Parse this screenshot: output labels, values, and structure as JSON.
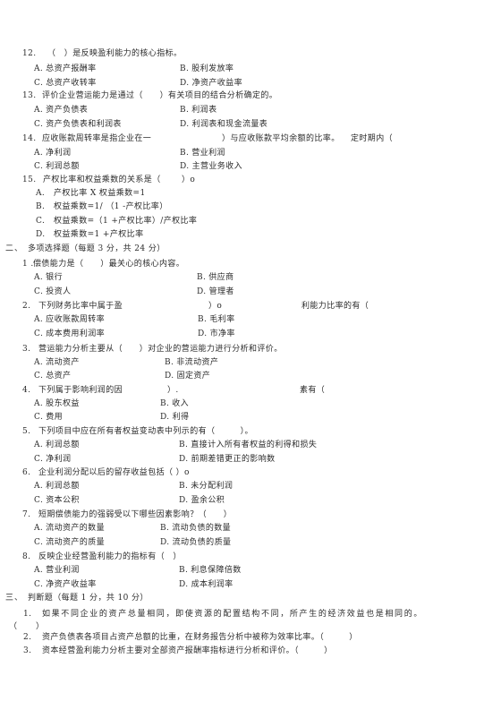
{
  "single_choice": {
    "questions": [
      {
        "number": "12.",
        "stem": [
          "（　）是反映盈利能力的核心指标。"
        ],
        "options": [
          {
            "label": "A.",
            "text": "总资产报酬率"
          },
          {
            "label": "B.",
            "text": "股利发放率"
          },
          {
            "label": "C.",
            "text": "总资产收转率"
          },
          {
            "label": "D.",
            "text": "净资产收益率"
          }
        ]
      },
      {
        "number": "13.",
        "stem": [
          "评价企业营运能力是通过（　　）有关项目的结合分析确定的。"
        ],
        "options": [
          {
            "label": "A.",
            "text": "资产负债表"
          },
          {
            "label": "B.",
            "text": "利润表"
          },
          {
            "label": "C.",
            "text": "资产负债表和利润表"
          },
          {
            "label": "D.",
            "text": "利润表和现金流量表"
          }
        ]
      },
      {
        "number": "14.",
        "stem": [
          "应收账款周转率是指企业在一",
          "）与应收账款平均余额的比率。",
          "定时期内（"
        ],
        "options": [
          {
            "label": "A.",
            "text": "净利润"
          },
          {
            "label": "B.",
            "text": "营业利润"
          },
          {
            "label": "C.",
            "text": "利润总额"
          },
          {
            "label": "D.",
            "text": "主营业务收入"
          }
        ]
      },
      {
        "number": "15.",
        "stem": [
          "产权比率和权益乘数的关系是（",
          "）o"
        ],
        "options": [
          {
            "label": "A.",
            "text": "产权比率 X 权益乘数=1"
          },
          {
            "label": "B.",
            "text": "权益乘数=1/ （1 -产权比率）"
          },
          {
            "label": "C.",
            "text": "权益乘数=（1 +产权比率）/产权比率"
          },
          {
            "label": "D.",
            "text": "权益乘数=1 +产权比率"
          }
        ]
      }
    ]
  },
  "multiple_choice": {
    "section_number": "二、",
    "title": "多项选择题（每题 3 分，共 24 分）",
    "questions": [
      {
        "number": "1 .",
        "stem": [
          "偿债能力是（　　）最关心的核心内容。"
        ],
        "options": [
          {
            "label": "A.",
            "text": "银行"
          },
          {
            "label": "B.",
            "text": "供应商"
          },
          {
            "label": "C.",
            "text": "投资人"
          },
          {
            "label": "D.",
            "text": "管理者"
          }
        ]
      },
      {
        "number": "2.",
        "stem": [
          "下列财务比率中属于盈",
          "）o",
          "利能力比率的有（"
        ],
        "options": [
          {
            "label": "A.",
            "text": "应收账款周转率"
          },
          {
            "label": "B.",
            "text": "毛利率"
          },
          {
            "label": "C.",
            "text": "成本费用利润率"
          },
          {
            "label": "D.",
            "text": "市净率"
          }
        ]
      },
      {
        "number": "3.",
        "stem": [
          "营运能力分析主要从（　　）对企业的营运能力进行分析和评价。"
        ],
        "options": [
          {
            "label": "A.",
            "text": "流动资产"
          },
          {
            "label": "B.",
            "text": "非流动资产"
          },
          {
            "label": "C.",
            "text": "总资产"
          },
          {
            "label": "D.",
            "text": "固定资产"
          }
        ]
      },
      {
        "number": "4.",
        "stem": [
          "下列属于影响利润的因",
          "）.",
          "素有（"
        ],
        "options": [
          {
            "label": "A.",
            "text": "股东权益"
          },
          {
            "label": "B.",
            "text": "收入"
          },
          {
            "label": "C.",
            "text": "费用"
          },
          {
            "label": "D.",
            "text": "利得"
          }
        ]
      },
      {
        "number": "5.",
        "stem": [
          "下列项目中应在所有者权益变动表中列示的有（　　　）。"
        ],
        "options": [
          {
            "label": "A.",
            "text": "利润总额"
          },
          {
            "label": "B.",
            "text": "直接计入所有者权益的利得和损失"
          },
          {
            "label": "C.",
            "text": "净利润"
          },
          {
            "label": "D.",
            "text": "前期差错更正的影响数"
          }
        ]
      },
      {
        "number": "6.",
        "stem": [
          "企业利润分配以后的留存收益包括（ ）o"
        ],
        "options": [
          {
            "label": "A.",
            "text": "利润总额"
          },
          {
            "label": "B.",
            "text": "未分配利润"
          },
          {
            "label": "C.",
            "text": "资本公积"
          },
          {
            "label": "D.",
            "text": "盈余公积"
          }
        ]
      },
      {
        "number": "7.",
        "stem": [
          "短期偿债能力的强弱受以下哪些因素影响？（　　）"
        ],
        "options": [
          {
            "label": "A.",
            "text": "流动资产的数量"
          },
          {
            "label": "B.",
            "text": "流动负债的数量"
          },
          {
            "label": "C.",
            "text": "流动资产的质量"
          },
          {
            "label": "D.",
            "text": "流动负债的质量"
          }
        ]
      },
      {
        "number": "8.",
        "stem": [
          "反映企业经营盈利能力的指标有（　）"
        ],
        "options": [
          {
            "label": "A.",
            "text": "营业利润"
          },
          {
            "label": "B.",
            "text": "利息保障倍数"
          },
          {
            "label": "C.",
            "text": "净资产收益率"
          },
          {
            "label": "D.",
            "text": "成本利润率"
          }
        ]
      }
    ]
  },
  "true_false": {
    "section_number": "三、",
    "title": "判断题（每题 1 分，共 10 分）",
    "questions": [
      {
        "number": "1.",
        "stem": "如果不同企业的资产总量相同，即使资源的配置结构不同，所产生的经济效益也是相同的。",
        "blank_open": "（",
        "blank_close": "）"
      },
      {
        "number": "2.",
        "stem": "资产负债表各项目占资产总额的比重，在财务报告分析中被称为效率比率。（　　　）"
      },
      {
        "number": "3.",
        "stem": "资本经营盈利能力分析主要对全部资产报酬率指标进行分析和评价。（　　　）"
      }
    ]
  }
}
